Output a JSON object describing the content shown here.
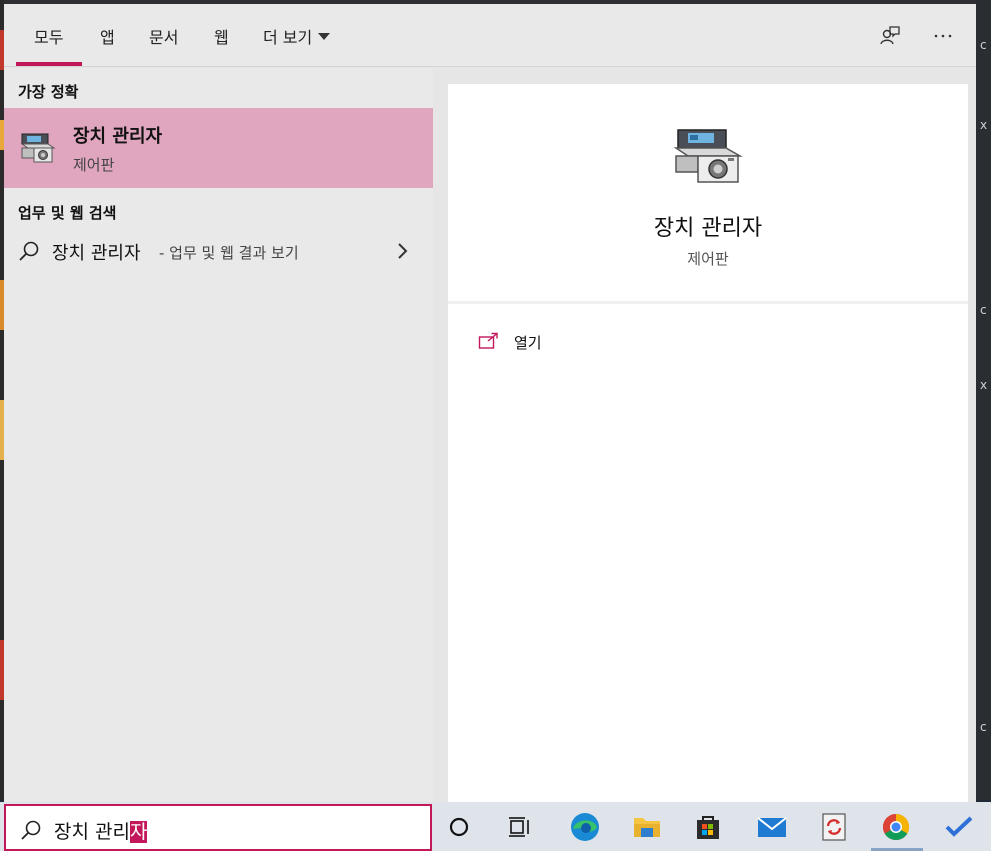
{
  "tabs": [
    {
      "label": "모두"
    },
    {
      "label": "앱"
    },
    {
      "label": "문서"
    },
    {
      "label": "웹"
    },
    {
      "label": "더 보기"
    }
  ],
  "top_icons": [
    "feedback-icon",
    "more-options-icon"
  ],
  "best_match": {
    "heading": "가장 정확",
    "title": "장치 관리자",
    "subtitle": "제어판",
    "icon": "device-manager-icon"
  },
  "web_search": {
    "heading": "업무 및 웹 검색",
    "query": "장치 관리자",
    "suffix": " - 업무 및 웹 결과 보기"
  },
  "detail": {
    "title": "장치 관리자",
    "subtitle": "제어판",
    "open_label": "열기"
  },
  "search": {
    "text_before": "장치 관리",
    "text_selected": "자"
  },
  "taskbar_icons": [
    "cortana-icon",
    "task-view-icon",
    "edge-icon",
    "file-explorer-icon",
    "store-icon",
    "mail-icon",
    "sync-app-icon",
    "chrome-icon",
    "todo-icon"
  ],
  "colors": {
    "accent": "#c2185b",
    "selected_result_bg": "#e0a6bf"
  }
}
